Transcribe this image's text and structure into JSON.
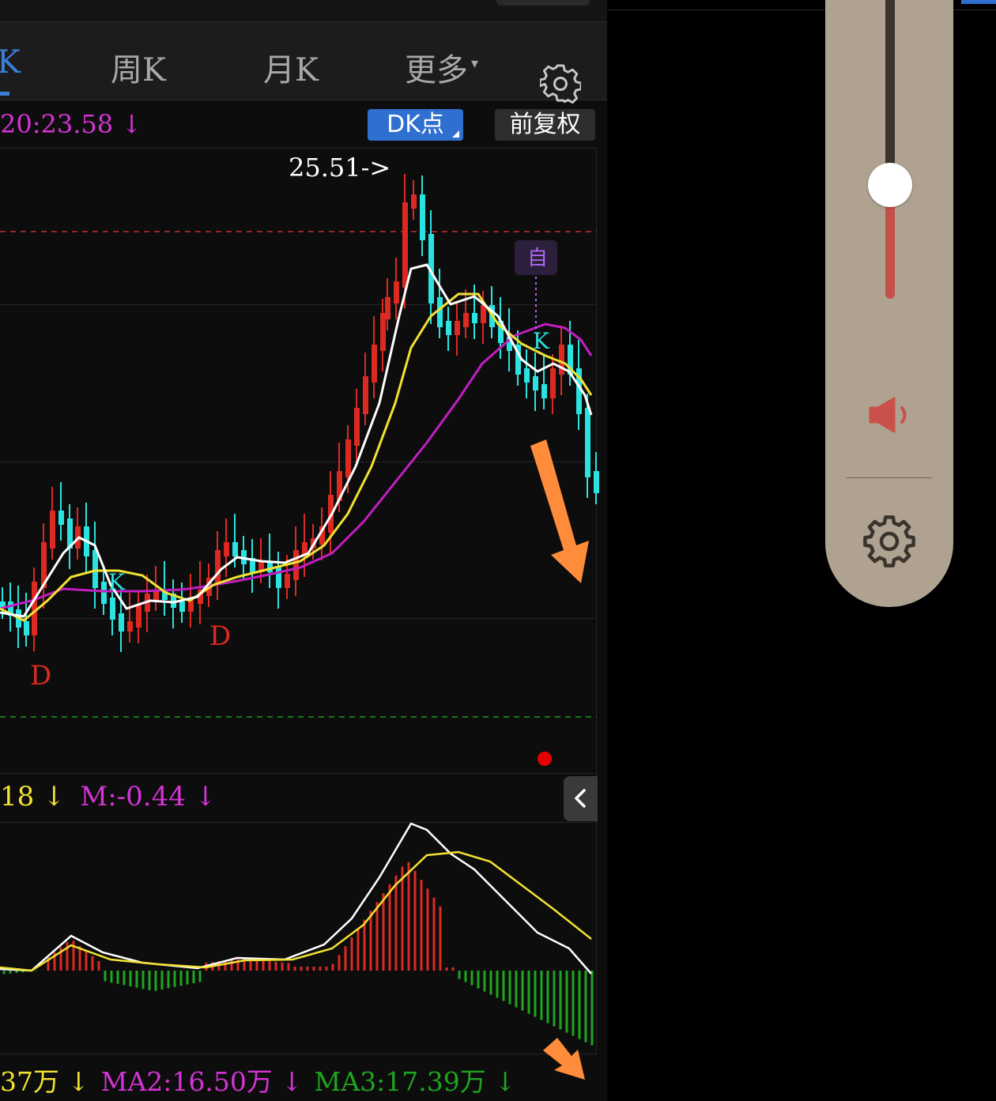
{
  "tabs": [
    {
      "label": "K",
      "active": true
    },
    {
      "label": "周K",
      "active": false
    },
    {
      "label": "月K",
      "active": false
    },
    {
      "label": "更多",
      "active": false
    }
  ],
  "icons": {
    "tabs_settings": "gear-icon",
    "more_caret": "▾",
    "collapse": "chevron-left-icon",
    "speaker": "speaker-icon",
    "panel_settings": "gear-icon"
  },
  "indicators": {
    "ma20_label": "20:23.58",
    "arrow": "↓"
  },
  "buttons": {
    "dk_points": "DK点",
    "forward_adjust": "前复权"
  },
  "chart_annotations": {
    "high_label": "25.51->",
    "custom_marker": "自",
    "signals": [
      "D",
      "D",
      "K",
      "K"
    ]
  },
  "macd": {
    "value1": "18",
    "value1_arrow": "↓",
    "m_label": "M:-0.44",
    "m_arrow": "↓"
  },
  "volume": {
    "ma1": "37万",
    "ma1_arrow": "↓",
    "ma2": "MA2:16.50万",
    "ma2_arrow": "↓",
    "ma3": "MA3:17.39万",
    "ma3_arrow": "↓"
  },
  "colors": {
    "up": "#dc2a22",
    "down": "#2ae3e0",
    "ma_white": "#ffffff",
    "ma_yellow": "#f2e233",
    "ma_magenta": "#c21ec2",
    "accent_blue": "#2f6fd0",
    "annotation_orange": "#ff8c3a"
  },
  "volume_control": {
    "level": 0.39
  }
}
